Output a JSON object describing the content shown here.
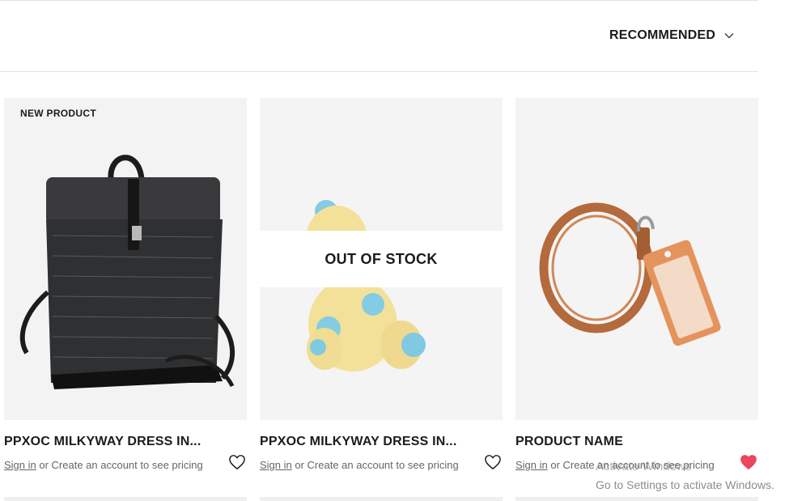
{
  "sort": {
    "label": "RECOMMENDED"
  },
  "products": [
    {
      "badge": "NEW PRODUCT",
      "name": "PPXOC MILKYWAY DRESS IN...",
      "sign_in": "Sign in",
      "pricing_rest": " or Create an account to see pricing",
      "favorite": false
    },
    {
      "overlay": "OUT OF STOCK",
      "name": "PPXOC MILKYWAY DRESS IN...",
      "sign_in": "Sign in",
      "pricing_rest": " or Create an account to see pricing",
      "favorite": false
    },
    {
      "name": "PRODUCT NAME",
      "sign_in": "Sign in",
      "pricing_rest": " or Create an account to see pricing",
      "favorite": true
    }
  ],
  "colors": {
    "heart_active": "#e8475f",
    "text": "#1b1b1b",
    "muted": "#666666"
  },
  "watermark": {
    "line1": "Activate Windows",
    "line2": "Go to Settings to activate Windows."
  }
}
